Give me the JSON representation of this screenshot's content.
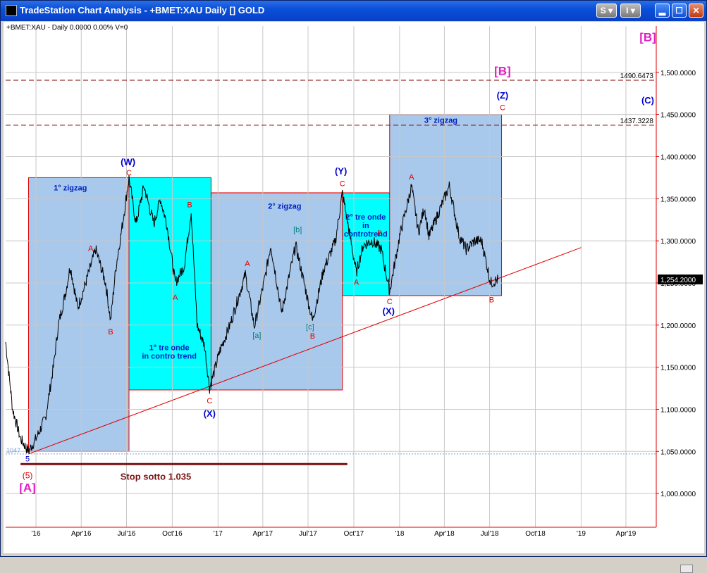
{
  "window": {
    "title": "TradeStation Chart Analysis - +BMET:XAU Daily [] GOLD",
    "buttons": {
      "s": "S",
      "i": "I"
    }
  },
  "chart_data": {
    "type": "line",
    "header": "+BMET:XAU - Daily  0.0000  0.00%  V=0",
    "y_axis": {
      "min": 960,
      "max": 1555,
      "ticks": [
        "1,000.0000",
        "1,050.0000",
        "1,100.0000",
        "1,150.0000",
        "1,200.0000",
        "1,250.0000",
        "1,300.0000",
        "1,350.0000",
        "1,400.0000",
        "1,450.0000",
        "1,500.0000"
      ],
      "tick_values": [
        1000,
        1050,
        1100,
        1150,
        1200,
        1250,
        1300,
        1350,
        1400,
        1450,
        1500
      ]
    },
    "x_axis": {
      "min": "2015-11-01",
      "max": "2019-06-01",
      "ticks": [
        {
          "label": "'16",
          "date": "2016-01-01"
        },
        {
          "label": "Apr'16",
          "date": "2016-04-01"
        },
        {
          "label": "Jul'16",
          "date": "2016-07-01"
        },
        {
          "label": "Oct'16",
          "date": "2016-10-01"
        },
        {
          "label": "'17",
          "date": "2017-01-01"
        },
        {
          "label": "Apr'17",
          "date": "2017-04-01"
        },
        {
          "label": "Jul'17",
          "date": "2017-07-01"
        },
        {
          "label": "Oct'17",
          "date": "2017-10-01"
        },
        {
          "label": "'18",
          "date": "2018-01-01"
        },
        {
          "label": "Apr'18",
          "date": "2018-04-01"
        },
        {
          "label": "Jul'18",
          "date": "2018-07-01"
        },
        {
          "label": "Oct'18",
          "date": "2018-10-01"
        },
        {
          "label": "'19",
          "date": "2019-01-01"
        },
        {
          "label": "Apr'19",
          "date": "2019-04-01"
        }
      ]
    },
    "series": [
      {
        "color": "#000000",
        "points": [
          [
            "2015-11-01",
            1180
          ],
          [
            "2015-11-15",
            1100
          ],
          [
            "2015-12-01",
            1065
          ],
          [
            "2015-12-17",
            1050
          ],
          [
            "2016-01-01",
            1065
          ],
          [
            "2016-01-20",
            1090
          ],
          [
            "2016-02-05",
            1150
          ],
          [
            "2016-02-15",
            1200
          ],
          [
            "2016-03-01",
            1240
          ],
          [
            "2016-03-10",
            1270
          ],
          [
            "2016-03-25",
            1220
          ],
          [
            "2016-04-10",
            1250
          ],
          [
            "2016-04-30",
            1290
          ],
          [
            "2016-05-20",
            1250
          ],
          [
            "2016-05-30",
            1205
          ],
          [
            "2016-06-10",
            1270
          ],
          [
            "2016-06-23",
            1320
          ],
          [
            "2016-07-06",
            1375
          ],
          [
            "2016-07-20",
            1320
          ],
          [
            "2016-08-05",
            1365
          ],
          [
            "2016-08-25",
            1320
          ],
          [
            "2016-09-07",
            1350
          ],
          [
            "2016-09-20",
            1320
          ],
          [
            "2016-10-07",
            1250
          ],
          [
            "2016-10-25",
            1270
          ],
          [
            "2016-11-08",
            1335
          ],
          [
            "2016-11-20",
            1200
          ],
          [
            "2016-12-05",
            1175
          ],
          [
            "2016-12-15",
            1125
          ],
          [
            "2017-01-05",
            1170
          ],
          [
            "2017-01-25",
            1200
          ],
          [
            "2017-02-25",
            1260
          ],
          [
            "2017-03-15",
            1198
          ],
          [
            "2017-04-05",
            1255
          ],
          [
            "2017-04-17",
            1295
          ],
          [
            "2017-05-09",
            1215
          ],
          [
            "2017-06-06",
            1295
          ],
          [
            "2017-07-10",
            1205
          ],
          [
            "2017-08-01",
            1265
          ],
          [
            "2017-08-25",
            1300
          ],
          [
            "2017-09-08",
            1357
          ],
          [
            "2017-09-25",
            1300
          ],
          [
            "2017-10-06",
            1262
          ],
          [
            "2017-10-20",
            1295
          ],
          [
            "2017-11-07",
            1300
          ],
          [
            "2017-11-25",
            1290
          ],
          [
            "2017-12-12",
            1240
          ],
          [
            "2018-01-01",
            1305
          ],
          [
            "2018-01-25",
            1365
          ],
          [
            "2018-02-08",
            1310
          ],
          [
            "2018-02-20",
            1340
          ],
          [
            "2018-03-01",
            1305
          ],
          [
            "2018-04-11",
            1365
          ],
          [
            "2018-05-01",
            1305
          ],
          [
            "2018-05-15",
            1290
          ],
          [
            "2018-06-01",
            1300
          ],
          [
            "2018-06-15",
            1300
          ],
          [
            "2018-07-03",
            1250
          ],
          [
            "2018-07-18",
            1254
          ]
        ]
      }
    ],
    "last_price_label": "1,254.2000",
    "price_lines": [
      {
        "value": 1490.6473,
        "label": "1490.6473"
      },
      {
        "value": 1437.3228,
        "label": "1437.3228"
      }
    ],
    "low_marker": {
      "value": 1047,
      "label": "1047"
    },
    "stop_line": {
      "value": 1035,
      "from": "2015-12-01",
      "to": "2017-09-18",
      "label": "Stop sotto 1.035"
    },
    "trendline": {
      "from": [
        "2015-12-17",
        1047
      ],
      "to": [
        "2019-01-01",
        1292
      ]
    },
    "boxes": [
      {
        "from": "2015-12-17",
        "to": "2016-07-06",
        "low": 1050,
        "high": 1375,
        "fill": "#a8c8ec",
        "label": "1° zigzag",
        "label_at": [
          "2016-03-10",
          1360
        ],
        "label_color": "#0020c0"
      },
      {
        "from": "2016-07-06",
        "to": "2016-12-18",
        "low": 1123,
        "high": 1375,
        "fill": "#00ffff",
        "label": "1° tre onde\nin contro trend",
        "label_at": [
          "2016-09-25",
          1170
        ],
        "label_color": "#0020c0"
      },
      {
        "from": "2016-12-18",
        "to": "2017-09-08",
        "low": 1123,
        "high": 1357,
        "fill": "#a8c8ec",
        "label": "2° zigzag",
        "label_at": [
          "2017-05-15",
          1338
        ],
        "label_color": "#0020c0"
      },
      {
        "from": "2017-09-08",
        "to": "2017-12-12",
        "low": 1235,
        "high": 1357,
        "fill": "#00ffff",
        "label": "2° tre onde\nin\ncontrotrend",
        "label_at": [
          "2017-10-25",
          1325
        ],
        "label_color": "#0020c0"
      },
      {
        "from": "2017-12-12",
        "to": "2018-07-25",
        "low": 1235,
        "high": 1450,
        "fill": "#a8c8ec",
        "label": "3° zigzag",
        "label_at": [
          "2018-03-25",
          1440
        ],
        "label_color": "#0020c0"
      }
    ],
    "annotations": [
      {
        "text": "(W)",
        "date": "2016-07-04",
        "value": 1390,
        "color": "#0000cc",
        "size": 13
      },
      {
        "text": "C",
        "date": "2016-07-06",
        "value": 1378,
        "color": "#e00000",
        "size": 11
      },
      {
        "text": "A",
        "date": "2016-04-20",
        "value": 1288,
        "color": "#e00000",
        "size": 11
      },
      {
        "text": "B",
        "date": "2016-05-30",
        "value": 1189,
        "color": "#e00000",
        "size": 11
      },
      {
        "text": "B",
        "date": "2016-11-05",
        "value": 1340,
        "color": "#e00000",
        "size": 11
      },
      {
        "text": "A",
        "date": "2016-10-07",
        "value": 1230,
        "color": "#e00000",
        "size": 11
      },
      {
        "text": "C",
        "date": "2016-12-15",
        "value": 1107,
        "color": "#e00000",
        "size": 11
      },
      {
        "text": "(X)",
        "date": "2016-12-15",
        "value": 1091,
        "color": "#0000cc",
        "size": 13
      },
      {
        "text": "A",
        "date": "2017-03-01",
        "value": 1270,
        "color": "#e00000",
        "size": 11
      },
      {
        "text": "[a]",
        "date": "2017-03-20",
        "value": 1185,
        "color": "#008080",
        "size": 11
      },
      {
        "text": "[b]",
        "date": "2017-06-10",
        "value": 1310,
        "color": "#008080",
        "size": 11
      },
      {
        "text": "[c]",
        "date": "2017-07-05",
        "value": 1195,
        "color": "#008080",
        "size": 11
      },
      {
        "text": "B",
        "date": "2017-07-10",
        "value": 1184,
        "color": "#e00000",
        "size": 11
      },
      {
        "text": "(Y)",
        "date": "2017-09-05",
        "value": 1379,
        "color": "#0000cc",
        "size": 13
      },
      {
        "text": "C",
        "date": "2017-09-08",
        "value": 1365,
        "color": "#e00000",
        "size": 11
      },
      {
        "text": "A",
        "date": "2017-10-06",
        "value": 1248,
        "color": "#e00000",
        "size": 11
      },
      {
        "text": "B",
        "date": "2017-11-22",
        "value": 1306,
        "color": "#e00000",
        "size": 11
      },
      {
        "text": "C",
        "date": "2017-12-12",
        "value": 1225,
        "color": "#e00000",
        "size": 11
      },
      {
        "text": "(X)",
        "date": "2017-12-10",
        "value": 1213,
        "color": "#0000cc",
        "size": 13
      },
      {
        "text": "A",
        "date": "2018-01-25",
        "value": 1373,
        "color": "#e00000",
        "size": 11
      },
      {
        "text": "B",
        "date": "2018-07-05",
        "value": 1227,
        "color": "#e00000",
        "size": 11
      },
      {
        "text": "C",
        "date": "2018-07-27",
        "value": 1455,
        "color": "#e00000",
        "size": 11
      },
      {
        "text": "(Z)",
        "date": "2018-07-27",
        "value": 1469,
        "color": "#0000cc",
        "size": 13
      },
      {
        "text": "[B]",
        "date": "2018-07-27",
        "value": 1497,
        "color": "#e020c0",
        "size": 17
      },
      {
        "text": "(C)",
        "date": "2019-05-15",
        "value": 1463,
        "color": "#0000cc",
        "size": 13
      },
      {
        "text": "[B]",
        "date": "2019-05-15",
        "value": 1537,
        "color": "#e020c0",
        "size": 17
      },
      {
        "text": "5",
        "date": "2015-12-15",
        "value": 1038,
        "color": "#0000cc",
        "size": 11
      },
      {
        "text": "(5)",
        "date": "2015-12-15",
        "value": 1018,
        "color": "#e00000",
        "size": 12
      },
      {
        "text": "[A]",
        "date": "2015-12-15",
        "value": 1002,
        "color": "#e020c0",
        "size": 17
      }
    ]
  }
}
